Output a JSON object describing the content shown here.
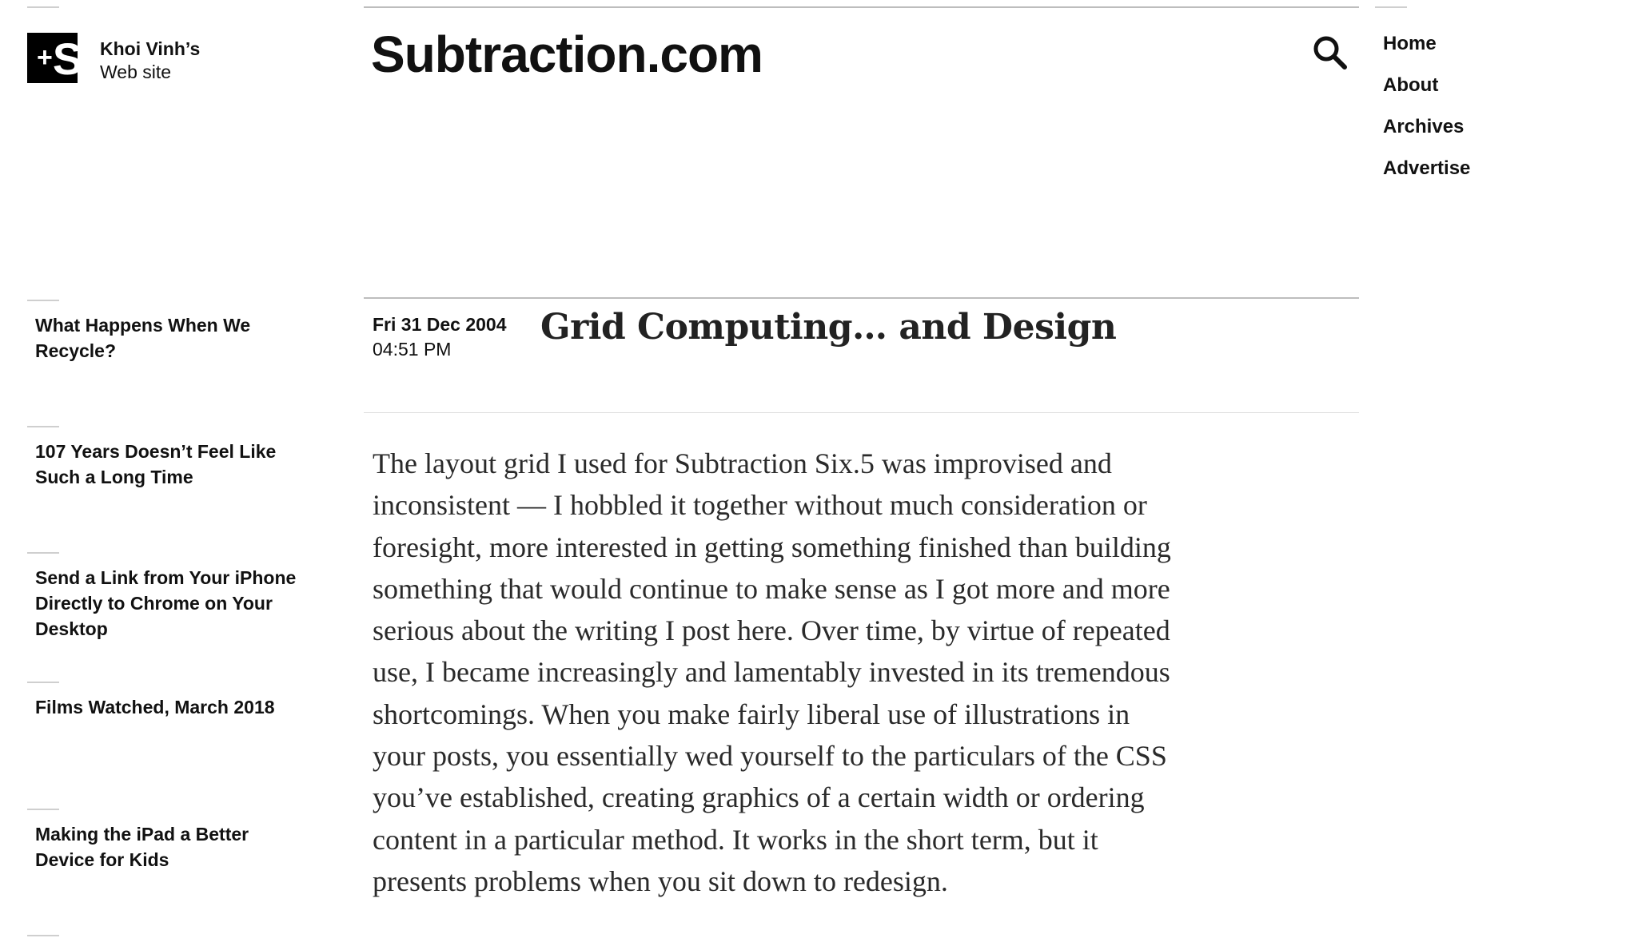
{
  "brand": {
    "logo_text": "+S",
    "owner": "Khoi Vinh’s",
    "subtitle": "Web site"
  },
  "site_title": "Subtraction.com",
  "nav": {
    "items": [
      {
        "label": "Home"
      },
      {
        "label": "About"
      },
      {
        "label": "Archives"
      },
      {
        "label": "Advertise"
      }
    ]
  },
  "sidebar": {
    "items": [
      {
        "label": "What Happens When We Recycle?"
      },
      {
        "label": "107 Years Doesn’t Feel Like Such a Long Time"
      },
      {
        "label": "Send a Link from Your iPhone Directly to Chrome on Your Desktop"
      },
      {
        "label": "Films Watched, March 2018"
      },
      {
        "label": "Making the iPad a Better Device for Kids"
      }
    ]
  },
  "post": {
    "date": "Fri 31 Dec 2004",
    "time": "04:51 PM",
    "title": "Grid Computing… and Design",
    "body": "The layout grid I used for Subtraction Six.5 was improvised and inconsistent — I hobbled it together without much consideration or foresight, more interested in getting something finished than building something that would continue to make sense as I got more and more serious about the writing I post here. Over time, by virtue of repeated use, I became increasingly and lamentably invested in its tremendous shortcomings. When you make fairly liberal use of illustrations in your posts, you essentially wed yourself to the particulars of the CSS you’ve established, creating graphics of a certain width or ordering content in a particular method. It works in the short term, but it presents problems when you sit down to redesign."
  },
  "icons": {
    "search": "search-icon"
  }
}
